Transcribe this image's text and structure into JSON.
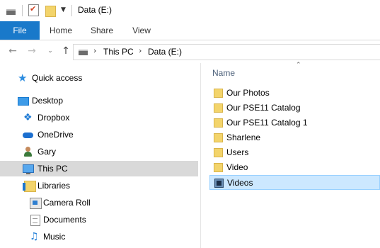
{
  "title_bar": {
    "title": "Data (E:)"
  },
  "ribbon": {
    "tabs": [
      {
        "label": "File"
      },
      {
        "label": "Home"
      },
      {
        "label": "Share"
      },
      {
        "label": "View"
      }
    ]
  },
  "address": {
    "breadcrumbs": [
      "This PC",
      "Data (E:)"
    ],
    "separator": "›"
  },
  "nav_pane": {
    "items": [
      {
        "label": "Quick access",
        "icon": "quick-access-star-icon"
      },
      {
        "label": "Desktop",
        "icon": "desktop-icon"
      },
      {
        "label": "Dropbox",
        "icon": "dropbox-icon"
      },
      {
        "label": "OneDrive",
        "icon": "onedrive-cloud-icon"
      },
      {
        "label": "Gary",
        "icon": "user-icon"
      },
      {
        "label": "This PC",
        "icon": "this-pc-icon",
        "selected": true
      },
      {
        "label": "Libraries",
        "icon": "libraries-icon"
      },
      {
        "label": "Camera Roll",
        "icon": "camera-roll-icon"
      },
      {
        "label": "Documents",
        "icon": "documents-icon"
      },
      {
        "label": "Music",
        "icon": "music-icon"
      }
    ]
  },
  "content": {
    "column_header": "Name",
    "files": [
      {
        "name": "Our Photos",
        "type": "folder"
      },
      {
        "name": "Our PSE11 Catalog",
        "type": "folder"
      },
      {
        "name": "Our PSE11 Catalog 1",
        "type": "folder"
      },
      {
        "name": "Sharlene",
        "type": "folder"
      },
      {
        "name": "Users",
        "type": "folder"
      },
      {
        "name": "Video",
        "type": "folder"
      },
      {
        "name": "Videos",
        "type": "video-folder",
        "selected": true
      }
    ]
  },
  "colors": {
    "file_tab": "#1979ca",
    "nav_selected": "#d9d9d9",
    "file_selected": "#cce8ff",
    "folder": "#f3d46b"
  }
}
